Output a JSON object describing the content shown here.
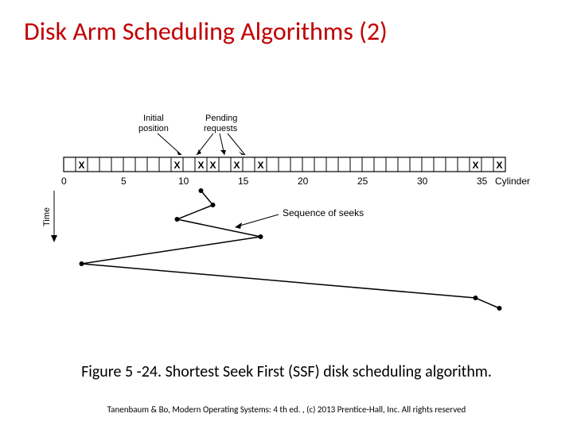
{
  "title": "Disk Arm Scheduling Algorithms (2)",
  "caption": "Figure 5 -24. Shortest Seek First (SSF) disk scheduling algorithm.",
  "footer": "Tanenbaum & Bo, Modern Operating Systems: 4 th ed. , (c) 2013 Prentice-Hall, Inc. All rights reserved",
  "labels": {
    "initial": "Initial",
    "position": "position",
    "pending": "Pending",
    "requests": "requests",
    "time": "Time",
    "sequence": "Sequence of seeks",
    "cylinder": "Cylinder"
  },
  "axis_ticks": [
    "0",
    "5",
    "10",
    "15",
    "20",
    "25",
    "30",
    "35"
  ],
  "chart_data": {
    "type": "line",
    "title": "Shortest Seek First (SSF) disk scheduling",
    "xlabel": "Cylinder",
    "ylabel": "Time",
    "xlim": [
      0,
      36
    ],
    "initial_position": 11,
    "pending_requests": [
      1,
      9,
      12,
      14,
      16,
      34,
      36
    ],
    "seek_sequence": [
      11,
      12,
      9,
      16,
      1,
      34,
      36
    ],
    "marked_cylinders": [
      1,
      9,
      11,
      12,
      14,
      16,
      34,
      36
    ]
  }
}
